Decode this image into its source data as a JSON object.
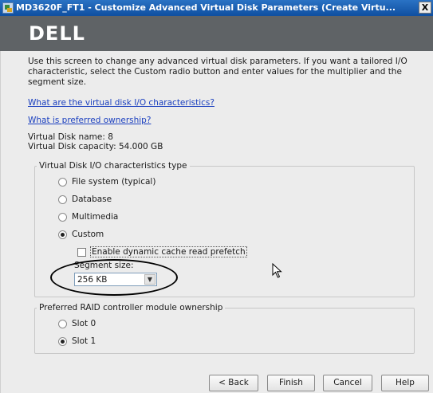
{
  "window": {
    "title": "MD3620F_FT1 - Customize Advanced Virtual Disk Parameters (Create Virtu...",
    "close_label": "X"
  },
  "banner": {
    "logo_text": "DELL"
  },
  "intro_text": "Use this screen to change any advanced virtual disk parameters. If you want a tailored I/O characteristic, select the Custom radio button and enter values for the multiplier and the segment size.",
  "links": {
    "io_characteristics": "What are the virtual disk I/O characteristics?",
    "preferred_ownership": "What is preferred ownership?"
  },
  "disk_info": {
    "name_line": "Virtual Disk name: 8",
    "capacity_line": "Virtual Disk capacity: 54.000 GB"
  },
  "io_group": {
    "legend": "Virtual Disk I/O characteristics type",
    "options": [
      {
        "label": "File system (typical)",
        "selected": false
      },
      {
        "label": "Database",
        "selected": false
      },
      {
        "label": "Multimedia",
        "selected": false
      },
      {
        "label": "Custom",
        "selected": true
      }
    ],
    "prefetch_label": "Enable dynamic cache read prefetch",
    "prefetch_checked": false,
    "segment_size_label": "Segment size:",
    "segment_size_value": "256 KB"
  },
  "ownership_group": {
    "legend": "Preferred RAID controller module ownership",
    "options": [
      {
        "label": "Slot 0",
        "selected": false
      },
      {
        "label": "Slot 1",
        "selected": true
      }
    ]
  },
  "buttons": {
    "back": "< Back",
    "finish": "Finish",
    "cancel": "Cancel",
    "help": "Help"
  }
}
